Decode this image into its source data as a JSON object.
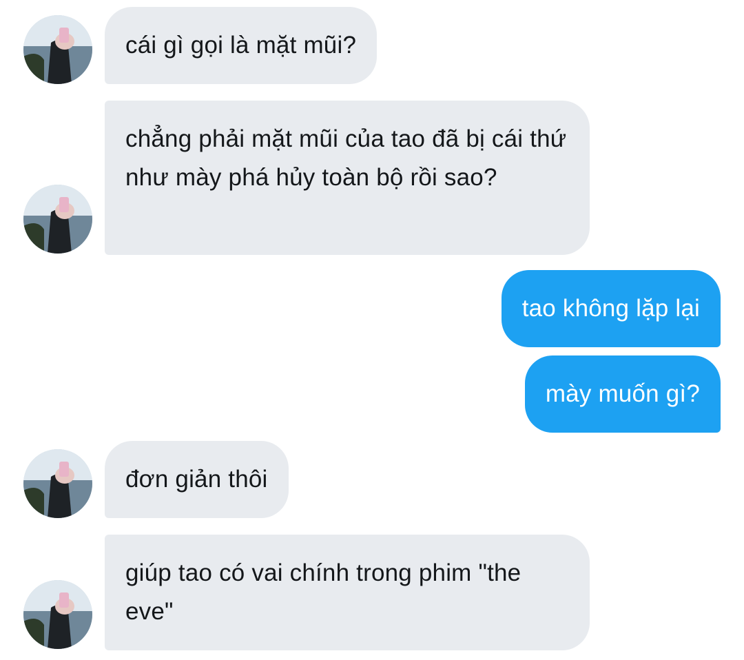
{
  "conversation": {
    "messages": [
      {
        "direction": "incoming",
        "text": "cái gì gọi là mặt mũi?"
      },
      {
        "direction": "incoming",
        "text": "chẳng phải mặt mũi của tao đã bị cái thứ như mày phá hủy toàn bộ rồi sao?"
      },
      {
        "direction": "outgoing",
        "text": "tao không lặp lại"
      },
      {
        "direction": "outgoing",
        "text": "mày muốn gì?"
      },
      {
        "direction": "incoming",
        "text": "đơn giản thôi"
      },
      {
        "direction": "incoming",
        "text": "giúp tao có vai chính trong phim \"the eve\""
      }
    ]
  },
  "colors": {
    "incoming_bubble": "#e8ebef",
    "outgoing_bubble": "#1da1f2",
    "incoming_text": "#14171a",
    "outgoing_text": "#ffffff"
  },
  "icons": {
    "avatar": "profile-photo"
  }
}
